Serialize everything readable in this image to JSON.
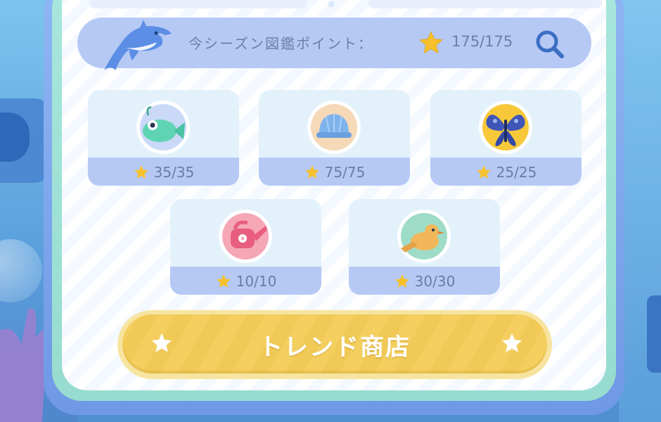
{
  "season_points": {
    "label": "今シーズン図鑑ポイント：",
    "value": "175/175"
  },
  "categories": [
    {
      "id": "fish",
      "icon": "fish-icon",
      "count": "35/35"
    },
    {
      "id": "shell",
      "icon": "shell-icon",
      "count": "75/75"
    },
    {
      "id": "insect",
      "icon": "butterfly-icon",
      "count": "25/25"
    },
    {
      "id": "tool",
      "icon": "watering-can-icon",
      "count": "10/10"
    },
    {
      "id": "bird",
      "icon": "bird-icon",
      "count": "30/30"
    }
  ],
  "shop_button": {
    "label": "トレンド商店"
  },
  "colors": {
    "accent_yellow": "#f4cf60",
    "panel_blue": "#b5c9f4",
    "text_muted": "#6d7ea8",
    "star": "#f6c12c"
  }
}
